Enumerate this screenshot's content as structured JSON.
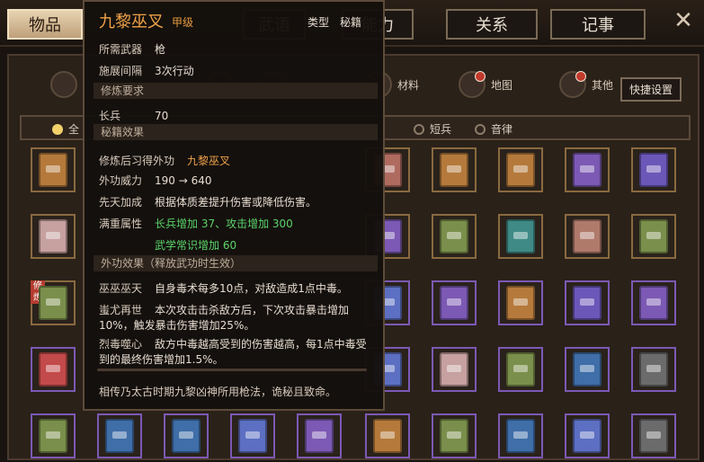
{
  "tabs": [
    {
      "label": "物品",
      "active": true
    },
    {
      "label": "武语",
      "active": false
    },
    {
      "label": "能力",
      "active": false
    },
    {
      "label": "关系",
      "active": false
    },
    {
      "label": "记事",
      "active": false
    }
  ],
  "topbar": {
    "close_icon": "close-icon"
  },
  "categories": [
    {
      "label": "",
      "icon": "bag-icon",
      "badge": false
    },
    {
      "label": "",
      "icon": "book-icon",
      "badge": false
    },
    {
      "label": "",
      "icon": "helmet-icon",
      "badge": false
    },
    {
      "label": "材料",
      "icon": "material-icon",
      "badge": false
    },
    {
      "label": "地图",
      "icon": "map-icon",
      "badge": true
    },
    {
      "label": "其他",
      "icon": "other-icon",
      "badge": true
    }
  ],
  "quickset_label": "快捷设置",
  "filters": [
    {
      "label": "全",
      "selected": true
    },
    {
      "label": "短兵",
      "selected": false
    },
    {
      "label": "音律",
      "selected": false
    }
  ],
  "tooltip": {
    "title": "九黎巫叉",
    "grade": "甲级",
    "type_label": "类型",
    "type_value": "秘籍",
    "rows": {
      "weapon_req": {
        "k": "所需武器",
        "v": "枪"
      },
      "cooldown": {
        "k": "施展间隔",
        "v": "3次行动"
      },
      "section_req": "修炼要求",
      "req_skill": {
        "k": "长兵",
        "v": "70"
      },
      "section_effect": "秘籍效果",
      "learn_skill": {
        "k": "修炼后习得外功",
        "v": "九黎巫叉"
      },
      "power": {
        "k": "外功威力",
        "v": "190 → 640"
      },
      "talent": {
        "k": "先天加成",
        "v": "根据体质差提升伤害或降低伤害。"
      },
      "bonus": {
        "k": "满重属性",
        "v": "长兵增加 37、攻击增加 300"
      },
      "bonus2": {
        "v": "武学常识增加 60"
      },
      "section_effect2": "外功效果（释放武功时生效）",
      "e1": {
        "k": "巫巫巫天",
        "v": "自身毒术每多10点，对敌造成1点中毒。"
      },
      "e2": {
        "k": "蚩尤再世",
        "v": "本次攻击击杀敌方后，下次攻击暴击增加10%，触发暴击伤害增加25%。"
      },
      "e3": {
        "k": "烈毒噬心",
        "v": "敌方中毒越高受到的伤害越高，每1点中毒受到的最终伤害增加1.5%。"
      }
    },
    "footer": "相传乃太古时期九黎凶神所用枪法，诡秘且致命。"
  },
  "colors": {
    "accent": "#f0a24a",
    "green": "#5bd36a"
  }
}
